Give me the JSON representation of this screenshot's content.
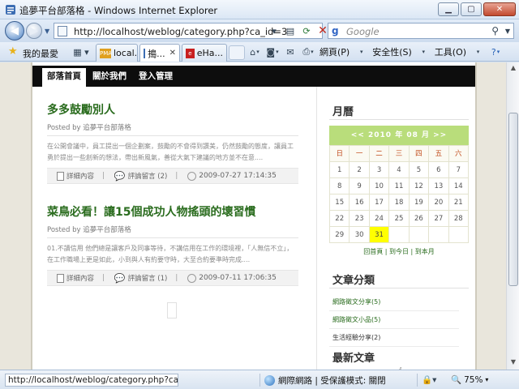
{
  "window": {
    "title": "追夢平台部落格 - Windows Internet Explorer"
  },
  "address": {
    "url": "http://localhost/weblog/category.php?ca_id=3"
  },
  "search": {
    "placeholder": "Google"
  },
  "favorites": {
    "label": "我的最愛"
  },
  "tabs": [
    {
      "label": "local...",
      "icon": "pma-icon"
    },
    {
      "label": "搗...",
      "icon": "ie-page-icon",
      "active": true
    },
    {
      "label": "eHa...",
      "icon": "ehappy-icon"
    }
  ],
  "commands": {
    "page": "網頁(P)",
    "safety": "安全性(S)",
    "tools": "工具(O)",
    "help_icon": "help-icon"
  },
  "site": {
    "nav": [
      "部落首頁",
      "關於我們",
      "登入管理"
    ],
    "posts": [
      {
        "title": "多多鼓勵別人",
        "meta": "Posted by 追夢平台部落格",
        "body": "在公開會議中，員工提出一個企劃案，鼓勵的不會得到讚美，仍然鼓勵的態度，讓員工勇於提出一些創新的想法，帶出新風氣，善從大氣下建議的地方並不在意....",
        "more": "詳細內容",
        "comments": "評論留言 (2)",
        "date": "2009-07-27 17:14:35"
      },
      {
        "title": "菜鳥必看！讓15個成功人物搖頭的壞習慣",
        "meta": "Posted by 追夢平台部落格",
        "body": "01.不讀信用 他們總是讓客戶及同事等待，不講信用在工作的環境裡，「人無信不立」，在工作職場上更是如此，小到與人有約要守時，大至合約要準時完成....",
        "more": "詳細內容",
        "comments": "評論留言 (1)",
        "date": "2009-07-11 17:06:35"
      }
    ],
    "sidebar": {
      "calendar_title": "月曆",
      "calendar_header": "<< 2010 年 08 月 >>",
      "weekdays": [
        "日",
        "一",
        "二",
        "三",
        "四",
        "五",
        "六"
      ],
      "weeks": [
        [
          "1",
          "2",
          "3",
          "4",
          "5",
          "6",
          "7"
        ],
        [
          "8",
          "9",
          "10",
          "11",
          "12",
          "13",
          "14"
        ],
        [
          "15",
          "16",
          "17",
          "18",
          "19",
          "20",
          "21"
        ],
        [
          "22",
          "23",
          "24",
          "25",
          "26",
          "27",
          "28"
        ],
        [
          "29",
          "30",
          "31",
          "",
          "",
          "",
          ""
        ]
      ],
      "today": "31",
      "calendar_links": "回首頁 | 到今日 | 到本月",
      "categories_title": "文章分類",
      "categories": [
        "網路徵文分享(5)",
        "網路徵文小品(5)",
        "生活經驗分享(2)"
      ],
      "latest_title": "最新文章"
    }
  },
  "status": {
    "url": "http://localhost/weblog/category.php?ca_id",
    "zone": "網際網路 | 受保護模式: 關閉",
    "zoom": "75%"
  },
  "colors": {
    "accent_green": "#2a6c1e",
    "calendar_header": "#b9dd7b",
    "today_highlight": "#ffff00",
    "nav_bar": "#0d0d0d"
  }
}
